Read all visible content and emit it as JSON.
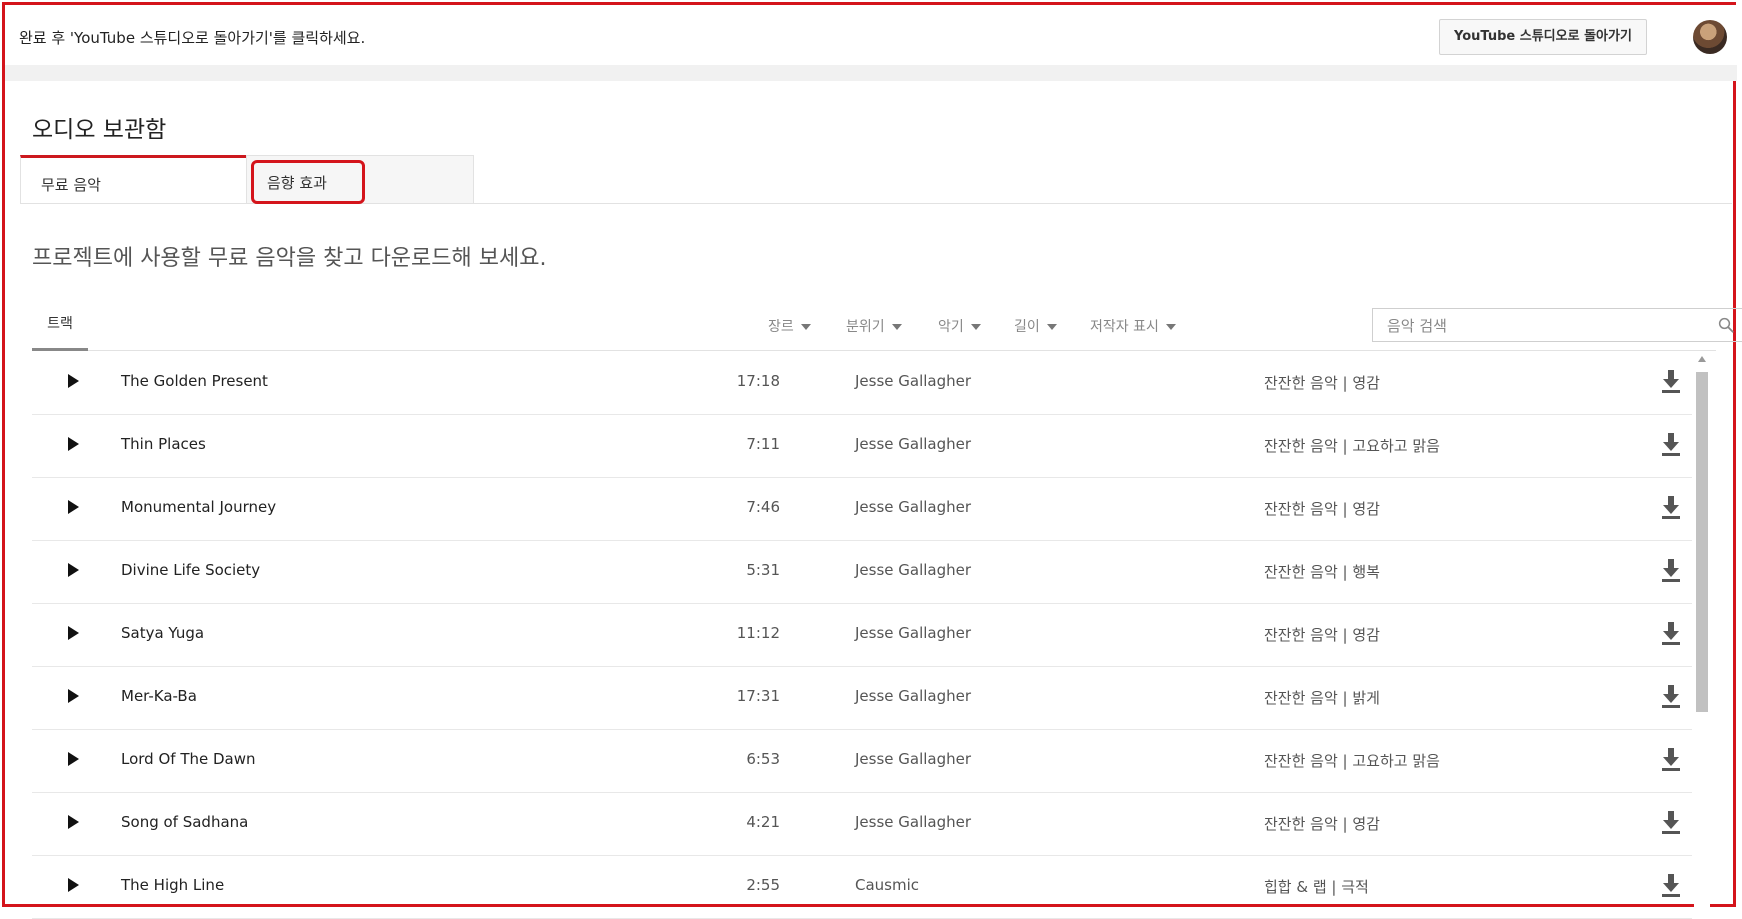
{
  "topbar": {
    "message": "완료 후 'YouTube 스튜디오로 돌아가기'를 클릭하세요.",
    "back_button": "YouTube 스튜디오로 돌아가기",
    "avatar_icon": "user-avatar"
  },
  "page": {
    "title": "오디오 보관함",
    "subtitle": "프로젝트에 사용할 무료 음악을 찾고 다운로드해 보세요."
  },
  "tabs": [
    {
      "label": "무료 음악",
      "active": true
    },
    {
      "label": "음향 효과",
      "active": false,
      "highlighted": true
    }
  ],
  "toolbar": {
    "tracks_tab": "트랙",
    "filters": [
      "장르",
      "분위기",
      "악기",
      "길이",
      "저작자 표시"
    ],
    "search_placeholder": "음악 검색",
    "search_icon": "search-icon"
  },
  "tracks": [
    {
      "title": "The Golden Present",
      "duration": "17:18",
      "artist": "Jesse Gallagher",
      "genre": "잔잔한 음악 | 영감"
    },
    {
      "title": "Thin Places",
      "duration": "7:11",
      "artist": "Jesse Gallagher",
      "genre": "잔잔한 음악 | 고요하고 맑음"
    },
    {
      "title": "Monumental Journey",
      "duration": "7:46",
      "artist": "Jesse Gallagher",
      "genre": "잔잔한 음악 | 영감"
    },
    {
      "title": "Divine Life Society",
      "duration": "5:31",
      "artist": "Jesse Gallagher",
      "genre": "잔잔한 음악 | 행복"
    },
    {
      "title": "Satya Yuga",
      "duration": "11:12",
      "artist": "Jesse Gallagher",
      "genre": "잔잔한 음악 | 영감"
    },
    {
      "title": "Mer-Ka-Ba",
      "duration": "17:31",
      "artist": "Jesse Gallagher",
      "genre": "잔잔한 음악 | 밝게"
    },
    {
      "title": "Lord Of The Dawn",
      "duration": "6:53",
      "artist": "Jesse Gallagher",
      "genre": "잔잔한 음악 | 고요하고 맑음"
    },
    {
      "title": "Song of Sadhana",
      "duration": "4:21",
      "artist": "Jesse Gallagher",
      "genre": "잔잔한 음악 | 영감"
    },
    {
      "title": "The High Line",
      "duration": "2:55",
      "artist": "Causmic",
      "genre": "힙합 & 랩 | 극적"
    }
  ],
  "colors": {
    "accent_red": "#cc181e",
    "highlight_border": "#d4141b"
  }
}
